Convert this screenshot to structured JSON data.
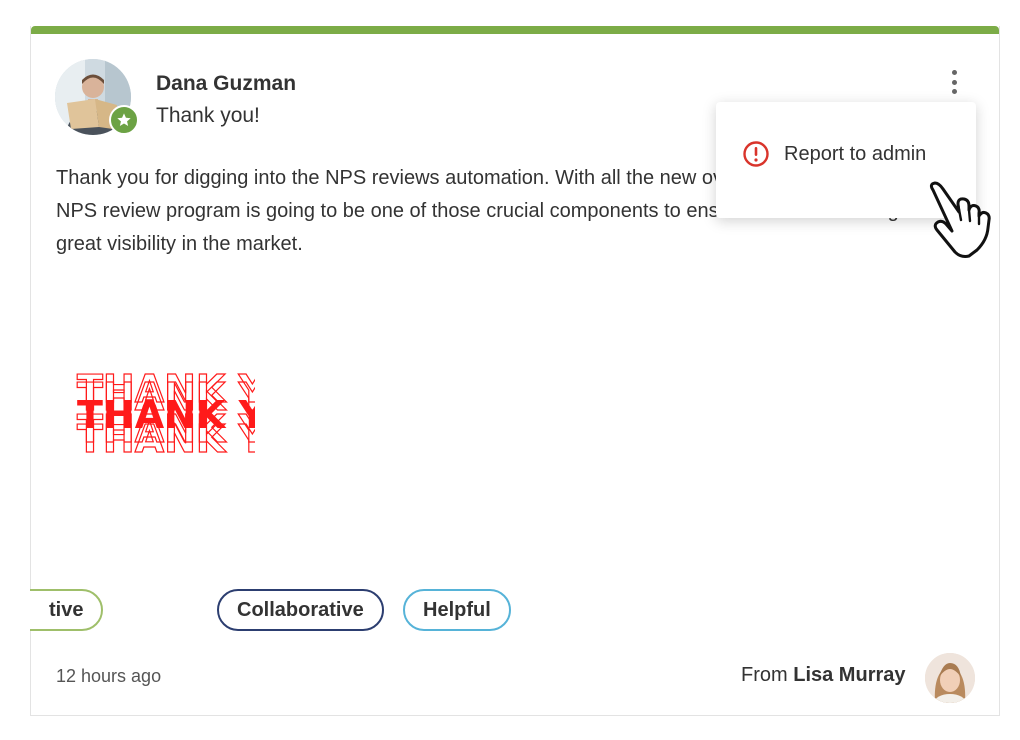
{
  "post": {
    "author_name": "Dana Guzman",
    "subtitle": "Thank you!",
    "body": "Thank you for digging into the NPS reviews automation. With all the new  over the next little while, the NPS review program is going to be one of those crucial components to ensure we continue to get great visibility in the market.",
    "gif_text": "THANK YOU",
    "tags": [
      "tive",
      "Collaborative",
      "Helpful"
    ],
    "timestamp": "12 hours ago",
    "from_label": "From",
    "from_name": "Lisa Murray"
  },
  "menu": {
    "report_label": "Report to admin"
  },
  "colors": {
    "accent_bar": "#7cac47",
    "badge": "#6ca244",
    "alert": "#d9342b",
    "gif": "#ff1a1a"
  },
  "icons": [
    "star-icon",
    "more-vertical-icon",
    "alert-circle-icon",
    "hand-pointer-icon"
  ]
}
